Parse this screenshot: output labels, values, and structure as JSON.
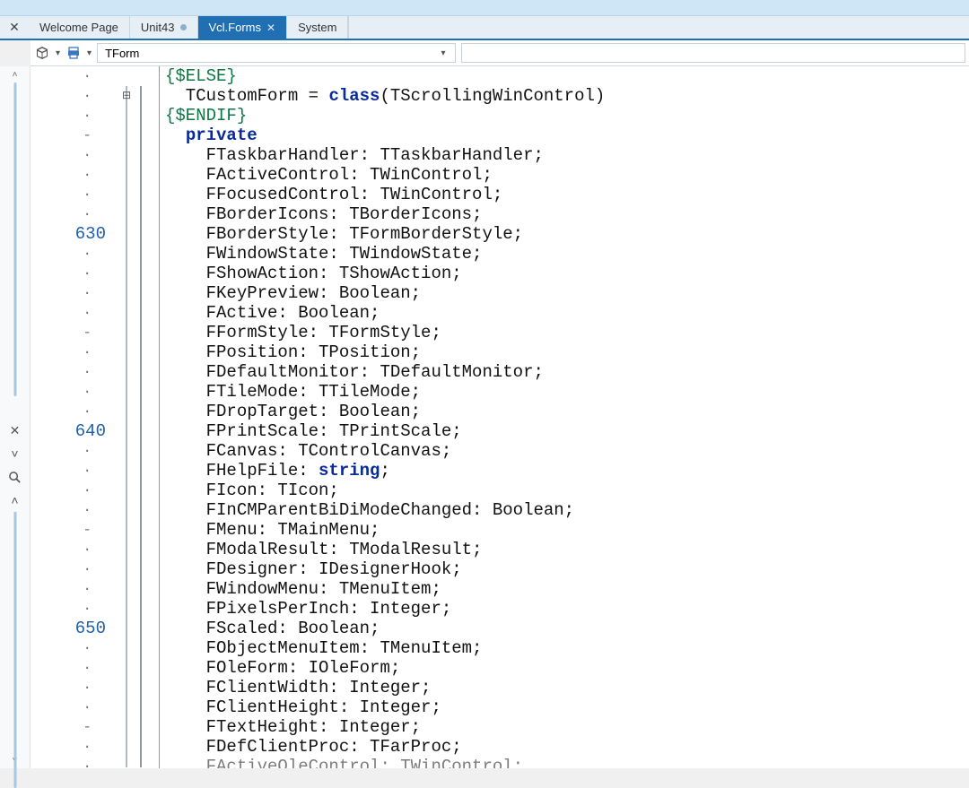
{
  "tabs": {
    "welcome": "Welcome Page",
    "unit43": "Unit43",
    "vclforms": "Vcl.Forms",
    "system": "System"
  },
  "nav": {
    "combo_value": "TForm"
  },
  "gutter": {
    "dot": "·",
    "dash": "-",
    "n630": "630",
    "n640": "640",
    "n650": "650"
  },
  "code": {
    "l0_a": "{$ELSE}",
    "l1_a": "  TCustomForm = ",
    "l1_b": "class",
    "l1_c": "(TScrollingWinControl)",
    "l2_a": "{$ENDIF}",
    "l3_a": "  ",
    "l3_b": "private",
    "l4": "    FTaskbarHandler: TTaskbarHandler;",
    "l5": "    FActiveControl: TWinControl;",
    "l6": "    FFocusedControl: TWinControl;",
    "l7": "    FBorderIcons: TBorderIcons;",
    "l8": "    FBorderStyle: TFormBorderStyle;",
    "l9": "    FWindowState: TWindowState;",
    "l10": "    FShowAction: TShowAction;",
    "l11": "    FKeyPreview: Boolean;",
    "l12": "    FActive: Boolean;",
    "l13": "    FFormStyle: TFormStyle;",
    "l14": "    FPosition: TPosition;",
    "l15": "    FDefaultMonitor: TDefaultMonitor;",
    "l16": "    FTileMode: TTileMode;",
    "l17": "    FDropTarget: Boolean;",
    "l18": "    FPrintScale: TPrintScale;",
    "l19": "    FCanvas: TControlCanvas;",
    "l20_a": "    FHelpFile: ",
    "l20_b": "string",
    "l20_c": ";",
    "l21": "    FIcon: TIcon;",
    "l22": "    FInCMParentBiDiModeChanged: Boolean;",
    "l23": "    FMenu: TMainMenu;",
    "l24": "    FModalResult: TModalResult;",
    "l25": "    FDesigner: IDesignerHook;",
    "l26": "    FWindowMenu: TMenuItem;",
    "l27": "    FPixelsPerInch: Integer;",
    "l28": "    FScaled: Boolean;",
    "l29": "    FObjectMenuItem: TMenuItem;",
    "l30": "    FOleForm: IOleForm;",
    "l31": "    FClientWidth: Integer;",
    "l32": "    FClientHeight: Integer;",
    "l33": "    FTextHeight: Integer;",
    "l34": "    FDefClientProc: TFarProc;",
    "l35": "    FActiveOleControl: TWinControl;"
  }
}
